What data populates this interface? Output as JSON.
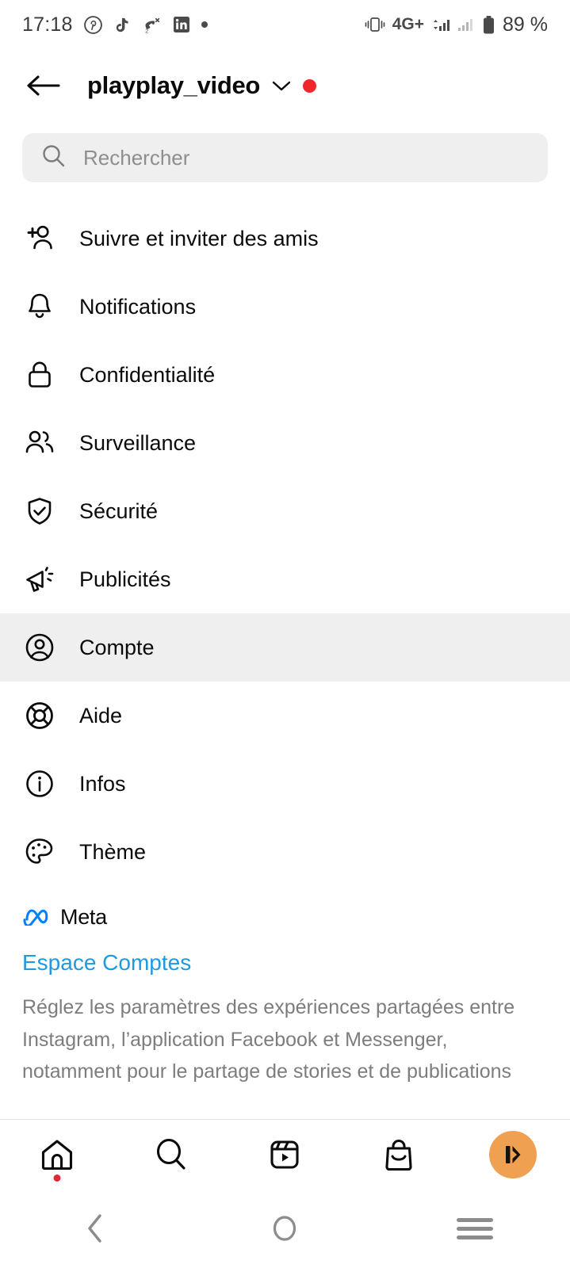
{
  "status_bar": {
    "time": "17:18",
    "left_icons": [
      "pinterest-icon",
      "tiktok-icon",
      "missed-call-icon",
      "linkedin-icon",
      "more-dot-icon"
    ],
    "missed_call_count": "2",
    "network_label": "4G+",
    "right_icons": [
      "vibrate-icon",
      "signal-bars-icon",
      "signal-bars-2-icon",
      "battery-icon"
    ],
    "battery": "89 %"
  },
  "header": {
    "back_icon": "arrow-left-icon",
    "title": "playplay_video",
    "chevron_icon": "chevron-down-icon",
    "badge_color": "#f0272a"
  },
  "search": {
    "icon": "search-icon",
    "placeholder": "Rechercher",
    "value": ""
  },
  "menu": {
    "items": [
      {
        "label": "Suivre et inviter des amis",
        "icon": "person-add-icon",
        "active": false
      },
      {
        "label": "Notifications",
        "icon": "bell-icon",
        "active": false
      },
      {
        "label": "Confidentialité",
        "icon": "lock-icon",
        "active": false
      },
      {
        "label": "Surveillance",
        "icon": "people-icon",
        "active": false
      },
      {
        "label": "Sécurité",
        "icon": "shield-check-icon",
        "active": false
      },
      {
        "label": "Publicités",
        "icon": "megaphone-icon",
        "active": false
      },
      {
        "label": "Compte",
        "icon": "account-circle-icon",
        "active": true
      },
      {
        "label": "Aide",
        "icon": "life-ring-icon",
        "active": false
      },
      {
        "label": "Infos",
        "icon": "info-circle-icon",
        "active": false
      },
      {
        "label": "Thème",
        "icon": "palette-icon",
        "active": false
      }
    ]
  },
  "meta_section": {
    "logo_icon": "meta-infinity-icon",
    "logo_color": "#0081fb",
    "brand": "Meta",
    "link": "Espace Comptes",
    "link_color": "#1e9ae0",
    "description": "Réglez les paramètres des expériences partagées entre Instagram, l’application Facebook et Messenger, notamment pour le partage de stories et de publications"
  },
  "bottom_nav": {
    "items": [
      {
        "icon": "home-icon",
        "badge": true
      },
      {
        "icon": "search-icon",
        "badge": false
      },
      {
        "icon": "reels-icon",
        "badge": false
      },
      {
        "icon": "shop-bag-icon",
        "badge": false
      },
      {
        "icon": "profile-avatar",
        "badge": false
      }
    ],
    "avatar_color": "#f0a051",
    "badge_color": "#e0283a"
  },
  "android_nav": {
    "back_icon": "nav-back-icon",
    "home_icon": "nav-home-icon",
    "recents_icon": "nav-recents-icon",
    "color": "#8c8c8c"
  }
}
